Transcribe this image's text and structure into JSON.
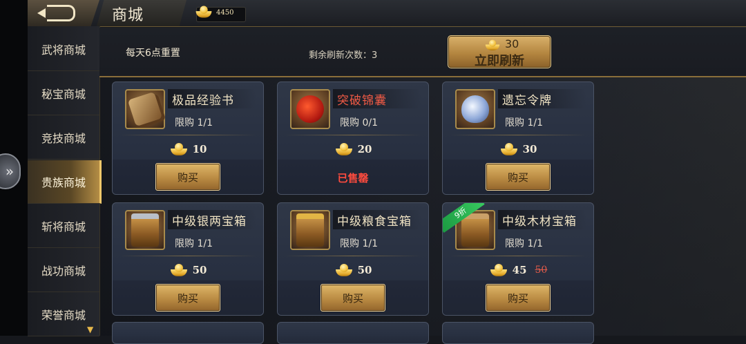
{
  "header": {
    "title": "商城",
    "gold_amount": "4450"
  },
  "sidebar": {
    "items": [
      {
        "label": "武将商城",
        "active": false
      },
      {
        "label": "秘宝商城",
        "active": false
      },
      {
        "label": "竞技商城",
        "active": false
      },
      {
        "label": "贵族商城",
        "active": true
      },
      {
        "label": "斩将商城",
        "active": false
      },
      {
        "label": "战功商城",
        "active": false
      },
      {
        "label": "荣誉商城",
        "active": false
      }
    ]
  },
  "info": {
    "reset_text": "每天6点重置",
    "refresh_remaining": "剩余刷新次数：3",
    "refresh_cost": "30",
    "refresh_button": "立即刷新"
  },
  "items": [
    {
      "name": "极品经验书",
      "limit": "限购 1/1",
      "price": "10",
      "action": "购买",
      "icon": "exp-book-icon",
      "name_color": "default"
    },
    {
      "name": "突破锦囊",
      "limit": "限购 0/1",
      "price": "20",
      "status": "已售罄",
      "icon": "red-pouch-icon",
      "name_color": "red"
    },
    {
      "name": "遗忘令牌",
      "limit": "限购 1/1",
      "price": "30",
      "action": "购买",
      "icon": "token-icon",
      "name_color": "default"
    },
    {
      "name": "中级银两宝箱",
      "limit": "限购 1/1",
      "price": "50",
      "action": "购买",
      "icon": "silver-chest-icon",
      "name_color": "default"
    },
    {
      "name": "中级粮食宝箱",
      "limit": "限购 1/1",
      "price": "50",
      "action": "购买",
      "icon": "food-chest-icon",
      "name_color": "default"
    },
    {
      "name": "中级木材宝箱",
      "limit": "限购 1/1",
      "price": "45",
      "old_price": "50",
      "discount": "9折",
      "action": "购买",
      "icon": "wood-chest-icon",
      "name_color": "default"
    }
  ],
  "colors": {
    "gold_accent": "#d9b16b",
    "sold_out": "#ff4b3e",
    "discount_green": "#2fb852"
  }
}
